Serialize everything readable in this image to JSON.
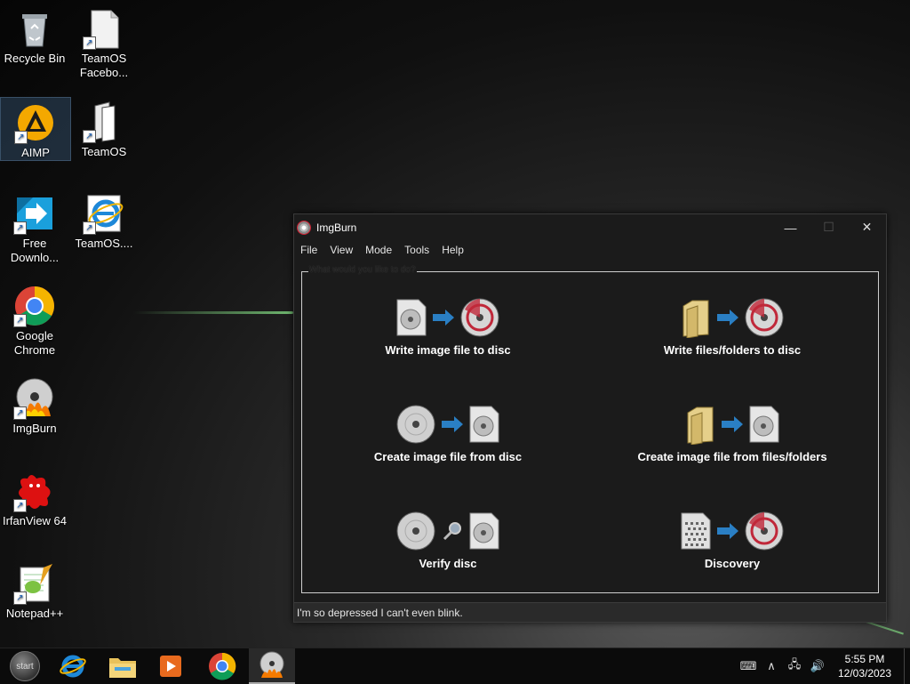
{
  "desktop": {
    "icons": [
      {
        "label": "Recycle Bin"
      },
      {
        "label": "TeamOS Facebo..."
      },
      {
        "label": "AIMP"
      },
      {
        "label": "TeamOS"
      },
      {
        "label": "Free Downlo..."
      },
      {
        "label": "TeamOS...."
      },
      {
        "label": "Google Chrome"
      },
      {
        "label": "ImgBurn"
      },
      {
        "label": "IrfanView 64"
      },
      {
        "label": "Notepad++"
      }
    ]
  },
  "window": {
    "title": "ImgBurn",
    "minimize": "—",
    "maximize": "☐",
    "close": "✕",
    "menu": [
      "File",
      "View",
      "Mode",
      "Tools",
      "Help"
    ],
    "group_title": "What would you like to do?",
    "actions": [
      {
        "label": "Write image file to disc"
      },
      {
        "label": "Write files/folders to disc"
      },
      {
        "label": "Create image file from disc"
      },
      {
        "label": "Create image file from files/folders"
      },
      {
        "label": "Verify disc"
      },
      {
        "label": "Discovery"
      }
    ],
    "status": "I'm so depressed I can't even blink."
  },
  "taskbar": {
    "start_label": "start",
    "clock_time": "5:55 PM",
    "clock_date": "12/03/2023"
  },
  "colors": {
    "accent_blue": "#2a7fc4",
    "disc_red": "#c0283a"
  }
}
